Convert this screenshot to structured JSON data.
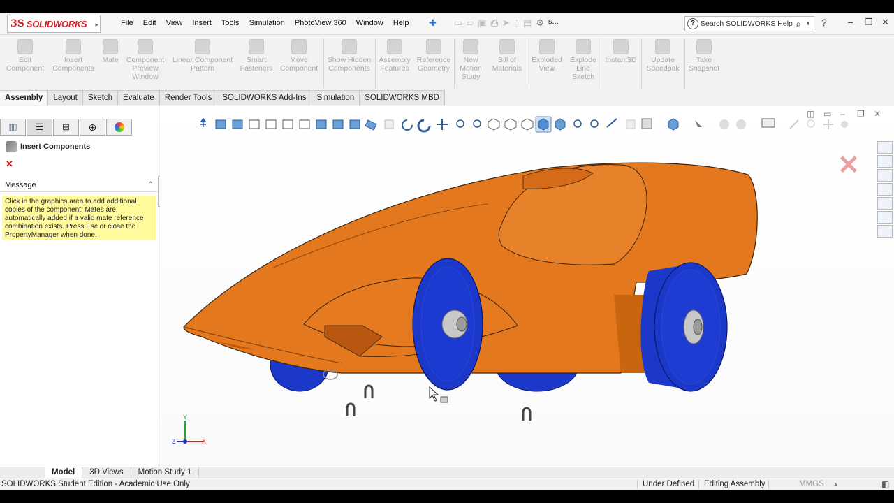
{
  "app": {
    "logo_ds": "3S",
    "logo_text": "SOLIDWORKS",
    "menu": [
      "File",
      "Edit",
      "View",
      "Insert",
      "Tools",
      "Simulation",
      "PhotoView 360",
      "Window",
      "Help"
    ],
    "doc_short": "s...",
    "search_placeholder": "Search SOLIDWORKS Help",
    "help_glyph": "?"
  },
  "command_manager": [
    {
      "label": "Edit Component"
    },
    {
      "label": "Insert Components"
    },
    {
      "label": "Mate"
    },
    {
      "label": "Component Preview Window"
    },
    {
      "label": "Linear Component Pattern"
    },
    {
      "label": "Smart Fasteners"
    },
    {
      "label": "Move Component"
    },
    {
      "label": "Show Hidden Components"
    },
    {
      "label": "Assembly Features"
    },
    {
      "label": "Reference Geometry"
    },
    {
      "label": "New Motion Study"
    },
    {
      "label": "Bill of Materials"
    },
    {
      "label": "Exploded View"
    },
    {
      "label": "Explode Line Sketch"
    },
    {
      "label": "Instant3D"
    },
    {
      "label": "Update Speedpak"
    },
    {
      "label": "Take Snapshot"
    }
  ],
  "tabs": [
    "Assembly",
    "Layout",
    "Sketch",
    "Evaluate",
    "Render Tools",
    "SOLIDWORKS Add-Ins",
    "Simulation",
    "SOLIDWORKS MBD"
  ],
  "property_manager": {
    "title": "Insert Components",
    "message_header": "Message",
    "message": "Click in the graphics area to add additional copies of the component. Mates are automatically added if a valid mate reference combination exists. Press Esc or close the PropertyManager when done."
  },
  "triad": {
    "x": "X",
    "y": "Y",
    "z": "Z"
  },
  "bottom_tabs": [
    "Model",
    "3D Views",
    "Motion Study 1"
  ],
  "status": {
    "edition": "SOLIDWORKS Student Edition - Academic Use Only",
    "definition": "Under Defined",
    "mode": "Editing Assembly",
    "units": "MMGS"
  },
  "colors": {
    "body_orange": "#e3781f",
    "wheel_blue": "#1b38c8",
    "message_bg": "#fffb9c",
    "logo_red": "#d01f26"
  }
}
